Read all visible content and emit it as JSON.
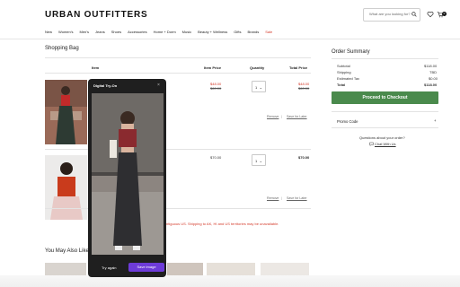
{
  "header": {
    "logo": "URBAN OUTFITTERS",
    "search_placeholder": "What are you looking for?",
    "cart_count": "0",
    "nav": [
      "New",
      "Women's",
      "Men's",
      "Jeans",
      "Shoes",
      "Accessories",
      "Home + Dorm",
      "Music",
      "Beauty + Wellness",
      "Gifts",
      "Brands",
      "Sale"
    ]
  },
  "bag": {
    "title": "Shopping Bag",
    "columns": {
      "item": "Item",
      "item_price": "Item Price",
      "quantity": "Quantity",
      "total_price": "Total Price"
    },
    "items": [
      {
        "price_sale": "$48.00",
        "price_orig": "$60.00",
        "qty": "1",
        "total_sale": "$48.00",
        "total_orig": "$60.00",
        "remove": "Remove",
        "save": "Save for Later"
      },
      {
        "price": "$70.00",
        "qty": "1",
        "total": "$70.00",
        "remove": "Remove",
        "save": "Save for Later"
      }
    ],
    "shipping_notice": "ntiguous US. Shipping to AK, HI and US territories may be unavailable."
  },
  "summary": {
    "title": "Order Summary",
    "rows": [
      {
        "label": "Subtotal",
        "value": "$118.00"
      },
      {
        "label": "Shipping",
        "value": "TBD"
      },
      {
        "label": "Estimated Tax",
        "value": "$0.00"
      },
      {
        "label": "Total",
        "value": "$118.00"
      }
    ],
    "checkout_label": "Proceed to Checkout",
    "promo_label": "Promo Code",
    "promo_icon": "+",
    "question": "Questions about your order?",
    "chat_label": "Chat With Us"
  },
  "also_like": {
    "title": "You May Also Like"
  },
  "tryon": {
    "title": "Digital Try-On",
    "close": "×",
    "try_again": "Try again",
    "save_image": "Save image"
  }
}
